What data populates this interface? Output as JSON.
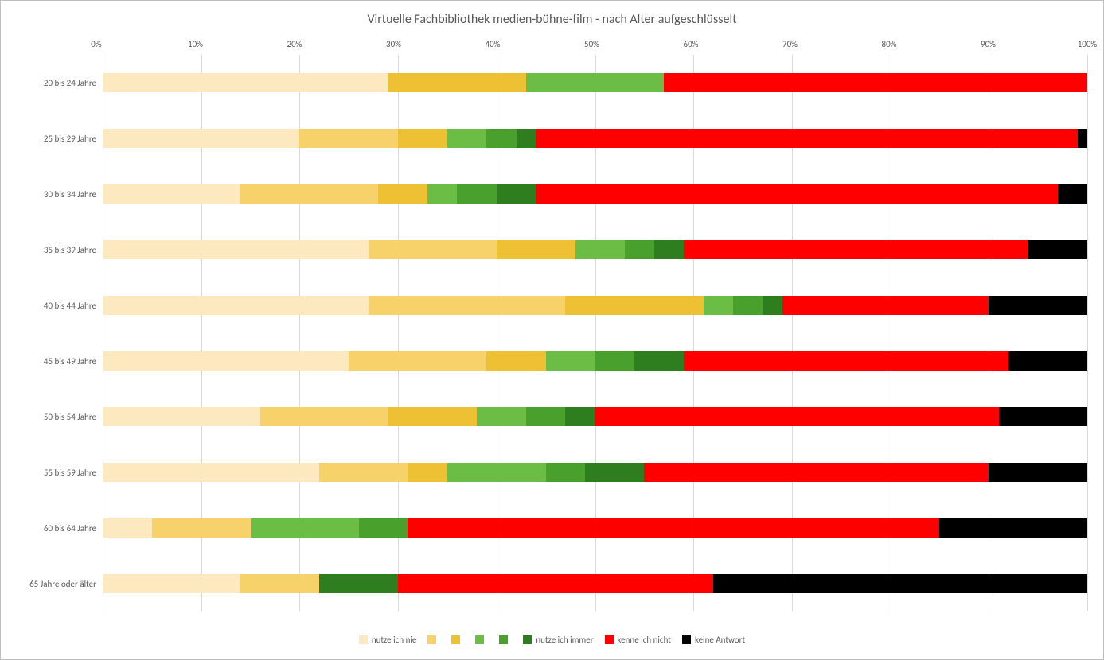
{
  "chart_data": {
    "type": "bar",
    "stacked": true,
    "orientation": "horizontal",
    "title": "Virtuelle Fachbibliothek medien-bühne-film - nach Alter aufgeschlüsselt",
    "x_axis": {
      "ticks": [
        "0%",
        "10%",
        "20%",
        "30%",
        "40%",
        "50%",
        "60%",
        "70%",
        "80%",
        "90%",
        "100%"
      ],
      "range": [
        0,
        100
      ],
      "position": "top"
    },
    "categories": [
      "20 bis 24 Jahre",
      "25 bis 29 Jahre",
      "30 bis 34 Jahre",
      "35 bis 39 Jahre",
      "40 bis 44 Jahre",
      "45 bis 49 Jahre",
      "50 bis 54 Jahre",
      "55 bis 59 Jahre",
      "60 bis 64 Jahre",
      "65 Jahre oder älter"
    ],
    "series": [
      {
        "name": "nutze ich nie",
        "color": "#fde9c0",
        "values": [
          29,
          20,
          14,
          27,
          27,
          25,
          16,
          22,
          5,
          14
        ]
      },
      {
        "name": "",
        "color": "#f7d26a",
        "values": [
          0,
          10,
          14,
          13,
          20,
          14,
          13,
          9,
          10,
          8
        ]
      },
      {
        "name": "",
        "color": "#eec135",
        "values": [
          14,
          5,
          5,
          8,
          14,
          6,
          9,
          4,
          0,
          0
        ]
      },
      {
        "name": "",
        "color": "#6cbd45",
        "values": [
          14,
          4,
          3,
          5,
          3,
          5,
          5,
          10,
          11,
          0
        ]
      },
      {
        "name": "",
        "color": "#4aa02c",
        "values": [
          0,
          3,
          4,
          3,
          3,
          4,
          4,
          4,
          5,
          0
        ]
      },
      {
        "name": "nutze ich immer",
        "color": "#2e7d1f",
        "values": [
          0,
          2,
          4,
          3,
          2,
          5,
          3,
          6,
          0,
          8
        ]
      },
      {
        "name": "kenne ich nicht",
        "color": "#ff0000",
        "values": [
          43,
          55,
          53,
          35,
          21,
          33,
          41,
          35,
          54,
          32
        ]
      },
      {
        "name": "keine Antwort",
        "color": "#000000",
        "values": [
          0,
          1,
          3,
          6,
          10,
          8,
          9,
          10,
          15,
          38
        ]
      }
    ],
    "legend_position": "bottom"
  }
}
